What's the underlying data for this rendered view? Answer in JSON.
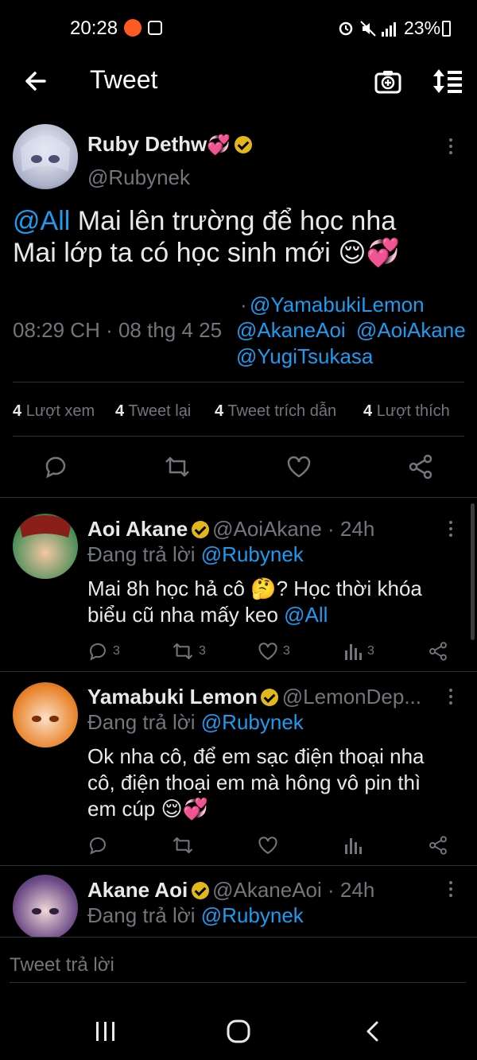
{
  "status_bar": {
    "time": "20:28",
    "battery_percent": "23%"
  },
  "header": {
    "title": "Tweet",
    "back_icon": "arrow-left-icon",
    "camera_icon": "camera-plus-icon",
    "sort_icon": "sort-icon"
  },
  "main_tweet": {
    "author_name": "Ruby Dethw",
    "author_handle": "@Rubynek",
    "text_mention": "@All",
    "text_line1": " Mai lên trường để học nha",
    "text_line2": "Mai lớp ta có học sinh mới 😌💞",
    "timestamp": "08:29 CH · 08 thg 4 25",
    "tags": [
      "@YamabukiLemon",
      "@AkaneAoi",
      "@AoiAkane",
      "@YugiTsukasa"
    ],
    "stats": [
      {
        "count": "4",
        "label": "Lượt xem"
      },
      {
        "count": "4",
        "label": "Tweet lại"
      },
      {
        "count": "4",
        "label": "Tweet trích dẫn"
      },
      {
        "count": "4",
        "label": "Lượt thích"
      }
    ]
  },
  "replies": [
    {
      "name": "Aoi Akane",
      "handle": "@AoiAkane · 24h",
      "replying_prefix": "Đang trả lời ",
      "replying_to": "@Rubynek",
      "text_line1": "Mai 8h học hả cô 🤔?  Học thời khóa",
      "text_line2": "biểu cũ nha mấy keo ",
      "text_mention": "@All",
      "actions": {
        "reply": "3",
        "retweet": "3",
        "like": "3",
        "views": "3"
      }
    },
    {
      "name": "Yamabuki Lemon",
      "handle": "@LemonDep...",
      "replying_prefix": "Đang trả lời ",
      "replying_to": "@Rubynek",
      "text_line1": "Ok nha cô, để em sạc điện thoại nha",
      "text_line2": "cô, điện thoại em mà hông vô pin thì",
      "text_line3": "em cúp 😌💞"
    },
    {
      "name": "Akane Aoi",
      "handle": "@AkaneAoi · 24h",
      "replying_prefix": "Đang trả lời ",
      "replying_to": "@Rubynek"
    }
  ],
  "reply_input": {
    "placeholder": "Tweet trả lời"
  },
  "colors": {
    "accent": "#1d9bf0",
    "muted": "#71767b",
    "verified": "#e2b719"
  }
}
